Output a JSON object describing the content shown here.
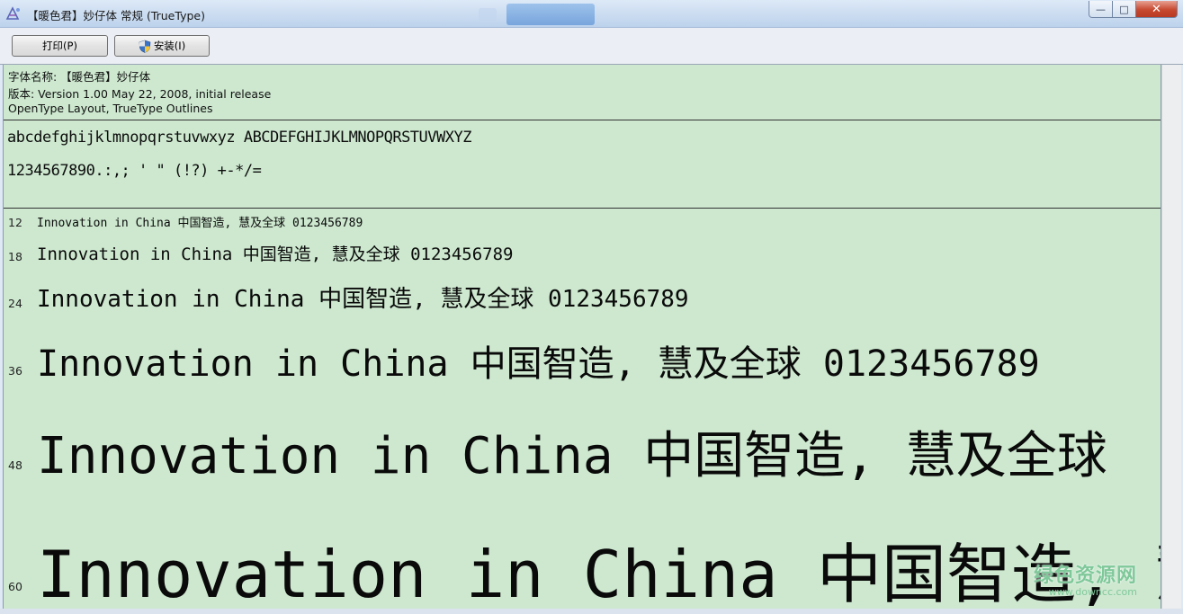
{
  "window": {
    "title": "【暖色君】妙仔体 常规 (TrueType)",
    "controls": {
      "minimize": "—",
      "maximize": "□",
      "close": "✕"
    }
  },
  "toolbar": {
    "print_label": "打印(P)",
    "install_label": "安装(I)"
  },
  "font_info": {
    "name_line": "字体名称: 【暖色君】妙仔体",
    "version_line": "版本: Version 1.00 May 22, 2008, initial release",
    "type_line": "OpenType Layout, TrueType Outlines"
  },
  "character_samples": {
    "letters": "abcdefghijklmnopqrstuvwxyz ABCDEFGHIJKLMNOPQRSTUVWXYZ",
    "digits_symbols": "1234567890.:,; ' \" (!?) +-*/="
  },
  "size_samples": [
    {
      "size": "12",
      "text": "Innovation in China 中国智造, 慧及全球 0123456789"
    },
    {
      "size": "18",
      "text": "Innovation in China 中国智造, 慧及全球 0123456789"
    },
    {
      "size": "24",
      "text": "Innovation in China 中国智造, 慧及全球 0123456789"
    },
    {
      "size": "36",
      "text": "Innovation in China 中国智造, 慧及全球 0123456789"
    },
    {
      "size": "48",
      "text": "Innovation in China 中国智造, 慧及全球"
    },
    {
      "size": "60",
      "text": "Innovation in China 中国智造, 慧"
    }
  ],
  "watermark": {
    "main": "绿色资源网",
    "sub": "www.downcc.com"
  },
  "colors": {
    "preview_background": "#cde8cf",
    "close_button": "#c7492f"
  }
}
